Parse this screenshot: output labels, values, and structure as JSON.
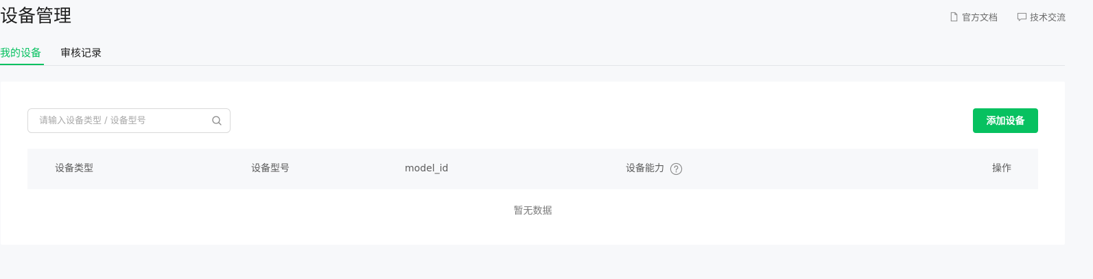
{
  "header": {
    "title": "设备管理",
    "links": [
      {
        "label": "官方文档",
        "icon": "document-icon"
      },
      {
        "label": "技术交流",
        "icon": "chat-icon"
      }
    ]
  },
  "tabs": [
    {
      "label": "我的设备",
      "active": true
    },
    {
      "label": "审核记录",
      "active": false
    }
  ],
  "toolbar": {
    "search_placeholder": "请输入设备类型 / 设备型号",
    "search_value": "",
    "add_button_label": "添加设备"
  },
  "table": {
    "columns": [
      "设备类型",
      "设备型号",
      "model_id",
      "设备能力",
      "操作"
    ],
    "rows": [],
    "empty_text": "暂无数据"
  },
  "colors": {
    "accent": "#07c160",
    "background": "#f7f8fa",
    "card": "#ffffff"
  }
}
